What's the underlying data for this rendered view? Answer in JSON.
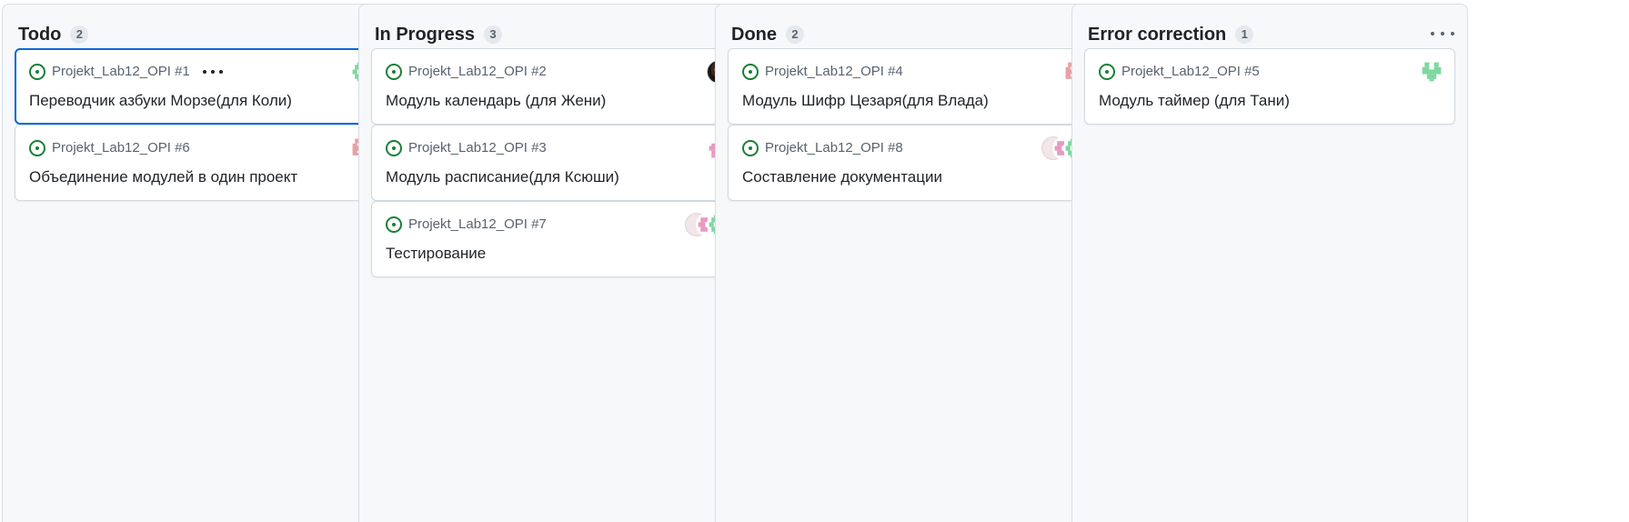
{
  "columns": [
    {
      "title": "Todo",
      "count": "2",
      "cards": [
        {
          "ref": "Projekt_Lab12_OPI #1",
          "title": "Переводчик азбуки Морзе(для Коли)",
          "avatars": [
            "identicon-green"
          ]
        },
        {
          "ref": "Projekt_Lab12_OPI #6",
          "title": "Объединение модулей в один проект",
          "avatars": [
            "identicon-red"
          ]
        }
      ]
    },
    {
      "title": "In Progress",
      "count": "3",
      "cards": [
        {
          "ref": "Projekt_Lab12_OPI #2",
          "title": "Модуль календарь (для Жени)",
          "avatars": [
            "photo-avatar"
          ]
        },
        {
          "ref": "Projekt_Lab12_OPI #3",
          "title": "Модуль расписание(для Ксюши)",
          "avatars": [
            "identicon-pink"
          ]
        },
        {
          "ref": "Projekt_Lab12_OPI #7",
          "title": "Тестирование",
          "avatars": [
            "faded-avatar",
            "identicon-pink",
            "identicon-green"
          ]
        }
      ]
    },
    {
      "title": "Done",
      "count": "2",
      "cards": [
        {
          "ref": "Projekt_Lab12_OPI #4",
          "title": "Модуль Шифр Цезаря(для Влада)",
          "avatars": [
            "identicon-red"
          ]
        },
        {
          "ref": "Projekt_Lab12_OPI #8",
          "title": "Составление документации",
          "avatars": [
            "faded-avatar",
            "identicon-pink",
            "identicon-green"
          ]
        }
      ]
    },
    {
      "title": "Error correction",
      "count": "1",
      "cards": [
        {
          "ref": "Projekt_Lab12_OPI #5",
          "title": "Модуль таймер (для Тани)",
          "avatars": [
            "identicon-green-alt"
          ]
        }
      ]
    }
  ],
  "colors": {
    "open_issue": "#1a7f37",
    "selected_border": "#0969da",
    "identicon_green": "#7fd8a0",
    "identicon_red": "#e8a0a8",
    "identicon_pink": "#e89ac0"
  }
}
